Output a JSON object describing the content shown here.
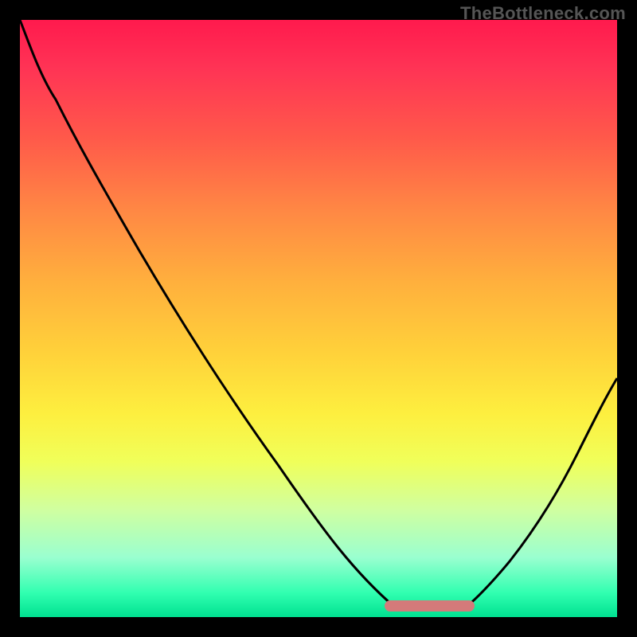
{
  "watermark": "TheBottleneck.com",
  "chart_data": {
    "type": "line",
    "title": "",
    "xlabel": "",
    "ylabel": "",
    "xlim": [
      0,
      1
    ],
    "ylim": [
      0,
      1
    ],
    "left_curve": {
      "x": [
        0.0,
        0.02,
        0.06,
        0.12,
        0.2,
        0.3,
        0.4,
        0.5,
        0.58,
        0.635
      ],
      "y": [
        1.0,
        0.96,
        0.87,
        0.76,
        0.62,
        0.47,
        0.33,
        0.19,
        0.085,
        0.01
      ]
    },
    "right_curve": {
      "x": [
        0.74,
        0.78,
        0.82,
        0.86,
        0.9,
        0.94,
        0.97,
        1.0
      ],
      "y": [
        0.01,
        0.03,
        0.065,
        0.115,
        0.18,
        0.26,
        0.33,
        0.4
      ]
    },
    "pink_segment": {
      "x_start": 0.61,
      "x_end": 0.76,
      "y": 0.018
    },
    "background_gradient": {
      "top": "#ff1a4d",
      "bottom": "#00e090"
    }
  }
}
